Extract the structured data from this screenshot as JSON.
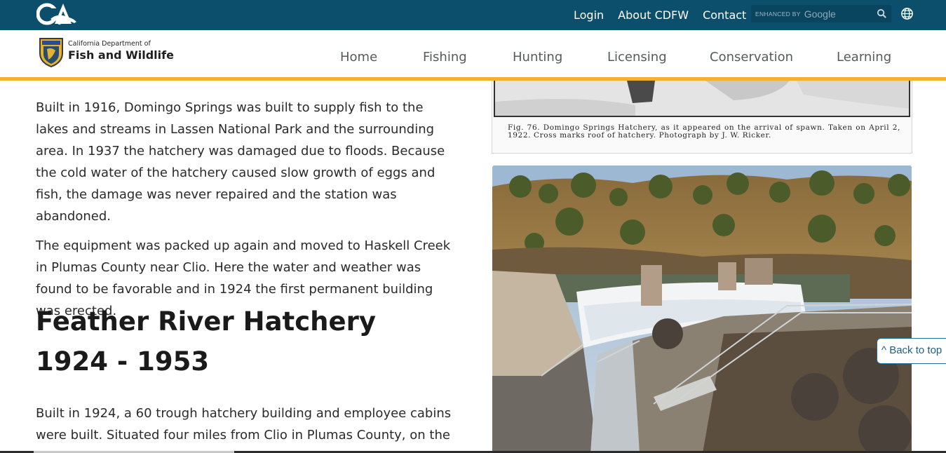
{
  "utility": {
    "links": [
      "Login",
      "About CDFW",
      "Contact"
    ],
    "search": {
      "enhanced_by": "ENHANCED BY",
      "provider": "Google"
    }
  },
  "header": {
    "org_sub": "California Department of",
    "org_main": "Fish and Wildlife"
  },
  "nav": {
    "items": [
      "Home",
      "Fishing",
      "Hunting",
      "Licensing",
      "Conservation",
      "Learning"
    ]
  },
  "main": {
    "paragraphs": [
      "Built in 1916, Domingo Springs was built to supply fish to the lakes and streams in Lassen National Park and the surrounding area. In 1937 the hatchery was damaged due to floods. Because the cold water of the hatchery caused slow growth of eggs and fish, the damage was never repaired and the station was abandoned.",
      "The equipment was packed up again and moved to Haskell Creek in Plumas County near Clio. Here the water and weather was found to be favorable and in 1924 the first permanent building was erected."
    ],
    "section_heading": "Feather River Hatchery 1924 - 1953",
    "paragraph3": "Built in 1924, a 60 trough hatchery building and employee cabins were built. Situated four miles from Clio in Plumas County, on the"
  },
  "figure": {
    "caption": "Fig. 76. Domingo Springs Hatchery, as it appeared on the arrival of spawn. Taken on April 2, 1922. Cross marks roof of hatchery. Photograph by J. W. Ricker."
  },
  "back_to_top": "^ Back to top",
  "colors": {
    "utility_bar": "#0b4f6c",
    "accent_gold": "#f0b22e",
    "link_blue": "#1d5f86"
  }
}
